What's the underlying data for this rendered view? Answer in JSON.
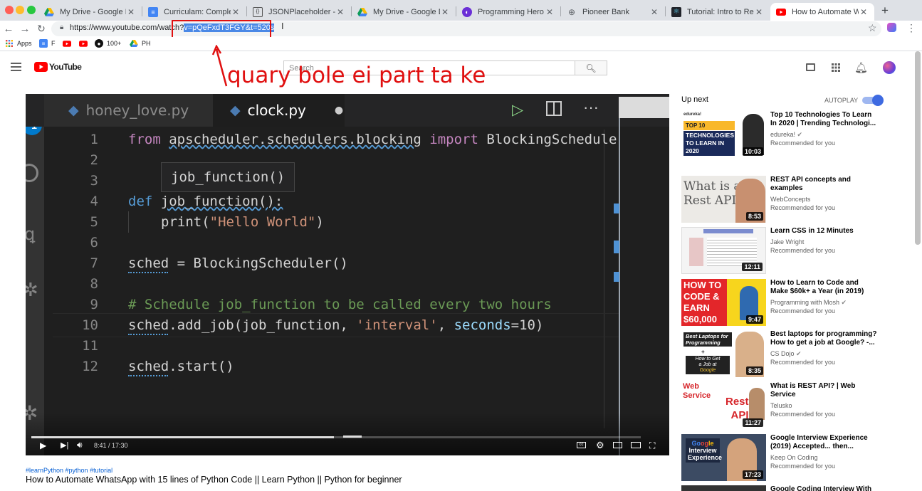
{
  "browser": {
    "tabs": [
      {
        "title": "My Drive - Google Drive",
        "icon": "google-drive-icon"
      },
      {
        "title": "Curriculam: Complete Web",
        "icon": "google-docs-icon"
      },
      {
        "title": "JSONPlaceholder - Fake o",
        "icon": "jsonplaceholder-icon"
      },
      {
        "title": "My Drive - Google Drive",
        "icon": "google-drive-icon"
      },
      {
        "title": "Programming Hero | Blog",
        "icon": "programming-hero-icon"
      },
      {
        "title": "Pioneer Bank",
        "icon": "globe-icon"
      },
      {
        "title": "Tutorial: Intro to React – Re",
        "icon": "react-icon"
      },
      {
        "title": "How to Automate WhatsAp",
        "icon": "youtube-icon",
        "active": true
      }
    ],
    "url_base": "https://www.youtube.com/watch?",
    "url_selected": "v=pQeFxdT3FGY&t=520s",
    "bookmarks": [
      {
        "label": "Apps",
        "icon": "apps-grid-icon"
      },
      {
        "label": "F",
        "icon": "google-docs-icon"
      },
      {
        "label": "",
        "icon": "youtube-icon"
      },
      {
        "label": "",
        "icon": "youtube-icon"
      },
      {
        "label": "100+",
        "icon": "github-icon"
      },
      {
        "label": "PH",
        "icon": "google-drive-icon"
      }
    ]
  },
  "annotation": "quary bole ei part ta ke",
  "youtube": {
    "logo": "YouTube",
    "search_placeholder": "Search"
  },
  "video": {
    "editor_tabs": [
      "honey_love.py",
      "clock.py"
    ],
    "autocomplete": "job_function()",
    "line_numbers": [
      "1",
      "2",
      "3",
      "4",
      "5",
      "6",
      "7",
      "8",
      "9",
      "10",
      "11",
      "12"
    ],
    "code": {
      "l1_kw": "from",
      "l1_mod": "apscheduler.schedulers.blocking",
      "l1_imp": "import",
      "l1_cls": "BlockingSchedule",
      "l4_def": "def",
      "l4_fn": "job_function():",
      "l5_fn": "print(",
      "l5_str": "\"Hello World\"",
      "l5_end": ")",
      "l7": "sched = BlockingScheduler()",
      "l9": "# Schedule job_function to be called every two hours",
      "l10_a": "sched.add_job(job_function, ",
      "l10_str": "'interval'",
      "l10_b": ", ",
      "l10_kw": "seconds",
      "l10_c": "=10)",
      "l12": "sched.start()"
    },
    "time": "8:41 / 17:30",
    "progress": 0.496
  },
  "sidebar": {
    "up_next": "Up next",
    "autoplay": "AUTOPLAY",
    "items": [
      {
        "title": "Top 10 Technologies To Learn In 2020 | Trending Technologi...",
        "channel": "edureka!",
        "verified": true,
        "rec": "Recommended for you",
        "duration": "10:03",
        "thumb_text": "TOP 10 TECHNOLOGIES TO LEARN IN 2020",
        "thumb_brand": "edureka!"
      },
      {
        "title": "REST API concepts and examples",
        "channel": "WebConcepts",
        "verified": false,
        "rec": "Recommended for you",
        "duration": "8:53",
        "thumb_text": "What is a Rest API?"
      },
      {
        "title": "Learn CSS in 12 Minutes",
        "channel": "Jake Wright",
        "verified": false,
        "rec": "Recommended for you",
        "duration": "12:11"
      },
      {
        "title": "How to Learn to Code and Make $60k+ a Year (in 2019)",
        "channel": "Programming with Mosh",
        "verified": true,
        "rec": "Recommended for you",
        "duration": "9:47",
        "thumb_text": "HOW TO CODE & EARN $60,000"
      },
      {
        "title": "Best laptops for programming? How to get a job at Google? -...",
        "channel": "CS Dojo",
        "verified": true,
        "rec": "Recommended for you",
        "duration": "8:35",
        "thumb_text": "Best Laptops for Programming + How to Get a Job at Google"
      },
      {
        "title": "What is REST API? | Web Service",
        "channel": "Telusko",
        "verified": false,
        "rec": "Recommended for you",
        "duration": "11:27",
        "thumb_text": "Web Service Rest API"
      },
      {
        "title": "Google Interview Experience (2019) Accepted... then...",
        "channel": "Keep On Coding",
        "verified": false,
        "rec": "Recommended for you",
        "duration": "17:23",
        "thumb_text": "Google Interview Experience"
      },
      {
        "title": "Google Coding Interview With A",
        "channel": "",
        "verified": false,
        "rec": "",
        "duration": ""
      }
    ]
  },
  "below_video": {
    "hashtags": "#learnPython #python #tutorial",
    "title": "How to Automate WhatsApp with 15 lines of Python Code || Learn Python || Python for beginner"
  },
  "colors": {
    "annotation": "#e01010",
    "youtube_red": "#ff0000",
    "vscode_bg": "#1e1e1e",
    "keyword": "#c586c0",
    "string": "#ce9178",
    "comment": "#6a9955",
    "autoplay": "#3e6ae1"
  }
}
